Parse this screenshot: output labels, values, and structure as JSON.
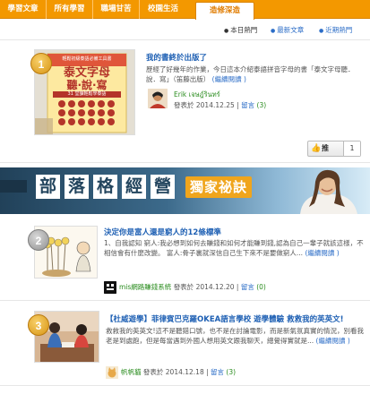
{
  "nav": {
    "tabs": [
      {
        "label": "學習文章"
      },
      {
        "label": "所有學習"
      },
      {
        "label": "職場甘苦"
      },
      {
        "label": "校園生活"
      },
      {
        "label": "造修深造"
      }
    ]
  },
  "subtabs": [
    {
      "label": "本日熱門"
    },
    {
      "label": "最新文章"
    },
    {
      "label": "近期熱門"
    }
  ],
  "posts": [
    {
      "rank": "1",
      "title": "我的書終於出版了",
      "excerpt": "歷經了好幾年的作業，今日這本介紹泰語拼音字母的書「泰文字母聽．說．寫」（笛藤出版）",
      "readmore": "(繼續閱讀 )",
      "author": "Erik เจษฎ์รินทร์",
      "published_label": "發表於",
      "date": "2014.12.25",
      "comments_label": "留言",
      "comments": "(3)"
    },
    {
      "rank": "2",
      "title": "決定你是富人還是窮人的12條標準",
      "excerpt": "1、自我認知 窮人:我必想到如何去賺錢和如何才能賺到錢,認為自己一輩子就該這樣，不相信會有什麼改變。 富人:骨子裏就深信自己生下來不是要做窮人...",
      "readmore": "(繼續閱讀 )",
      "author": "mis網路賺錢系統",
      "published_label": "發表於",
      "date": "2014.12.20",
      "comments_label": "留言",
      "comments": "(0)"
    },
    {
      "rank": "3",
      "title": "【杜威遊學】菲律賓巴克羅OKEA語言學校 遊學體驗 救救我的英英文!",
      "excerpt": "救救我的英英文!這不是聽錯口號，也不是在討論電影，而是新氣氛真實的情況，別看我老是到處跑，但是每當遇到外國人想用英文跟我聊天，總覺得實就是...",
      "readmore": "(繼續閱讀 )",
      "author": "帆帆貓",
      "published_label": "發表於",
      "date": "2014.12.18",
      "comments_label": "留言",
      "comments": "(3)"
    }
  ],
  "book_cover": {
    "title_line1": "泰文字母",
    "title_line2": "聽·說·寫",
    "subtitle": "31 堂課輕鬆學泰語",
    "top_line": "輕鬆初級泰語必備工具書"
  },
  "like": {
    "label": "推",
    "count": "1"
  },
  "banner": {
    "chars": [
      "部",
      "落",
      "格",
      "經",
      "營"
    ],
    "badge": "獨家祕訣"
  },
  "colors": {
    "accent": "#f39800",
    "link": "#1d5fb3",
    "author": "#2a8c1e"
  }
}
